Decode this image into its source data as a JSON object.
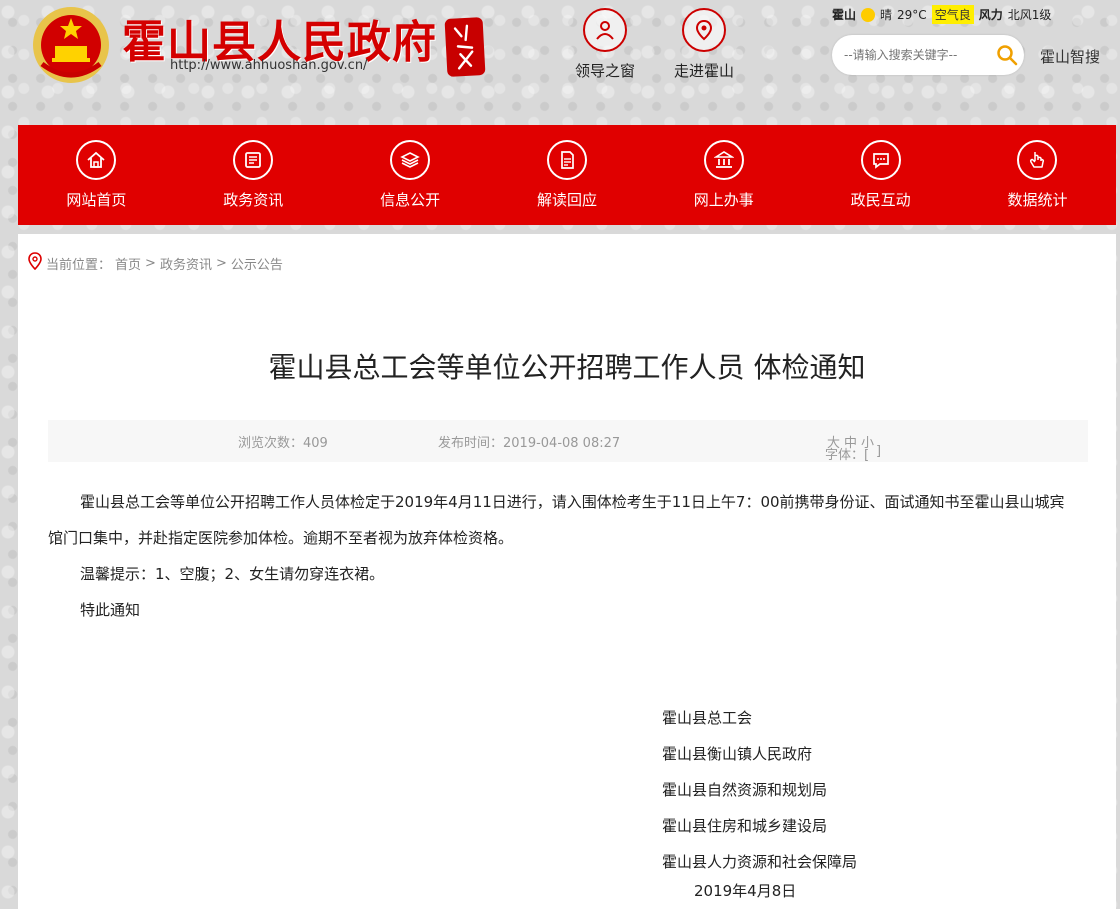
{
  "header": {
    "site_title": "霍山县人民政府",
    "site_url": "http://www.ahhuoshan.gov.cn/",
    "quick_links": [
      {
        "label": "领导之窗",
        "icon": "person-icon"
      },
      {
        "label": "走进霍山",
        "icon": "location-pin-icon"
      }
    ],
    "weather": {
      "city": "霍山",
      "condition": "晴",
      "temperature": "29°C",
      "air_quality": "空气良",
      "wind_label": "风力",
      "wind_value": "北风1级"
    },
    "search": {
      "placeholder": "--请输入搜索关键字--"
    },
    "smart_link": "霍山智搜"
  },
  "nav": {
    "items": [
      {
        "label": "网站首页",
        "icon": "home-icon"
      },
      {
        "label": "政务资讯",
        "icon": "newspaper-icon"
      },
      {
        "label": "信息公开",
        "icon": "layers-icon"
      },
      {
        "label": "解读回应",
        "icon": "document-icon"
      },
      {
        "label": "网上办事",
        "icon": "bank-icon"
      },
      {
        "label": "政民互动",
        "icon": "chat-icon"
      },
      {
        "label": "数据统计",
        "icon": "hand-pointer-icon"
      }
    ]
  },
  "breadcrumb": {
    "prefix": "当前位置：",
    "items": [
      "首页",
      "政务资讯",
      "公示公告"
    ],
    "separator": ">"
  },
  "article": {
    "title": "霍山县总工会等单位公开招聘工作人员 体检通知",
    "views": "浏览次数：409",
    "published": "发布时间：2019-04-08 08:27",
    "font_size_label": "字体：[",
    "font_size_options": [
      "大",
      "中",
      "小"
    ],
    "font_size_end": "]",
    "paragraphs": [
      "霍山县总工会等单位公开招聘工作人员体检定于2019年4月11日进行，请入围体检考生于11日上午7：00前携带身份证、面试通知书至霍山县山城宾馆门口集中，并赴指定医院参加体检。逾期不至者视为放弃体检资格。",
      "温馨提示：1、空腹；2、女生请勿穿连衣裙。",
      "特此通知"
    ],
    "signers": [
      "霍山县总工会",
      "霍山县衡山镇人民政府",
      "霍山县自然资源和规划局",
      "霍山县住房和城乡建设局",
      "霍山县人力资源和社会保障局"
    ],
    "date": "2019年4月8日"
  },
  "colors": {
    "brand_red": "#e00000",
    "title_red": "#d40000",
    "air_quality_bg": "#ffee00"
  }
}
